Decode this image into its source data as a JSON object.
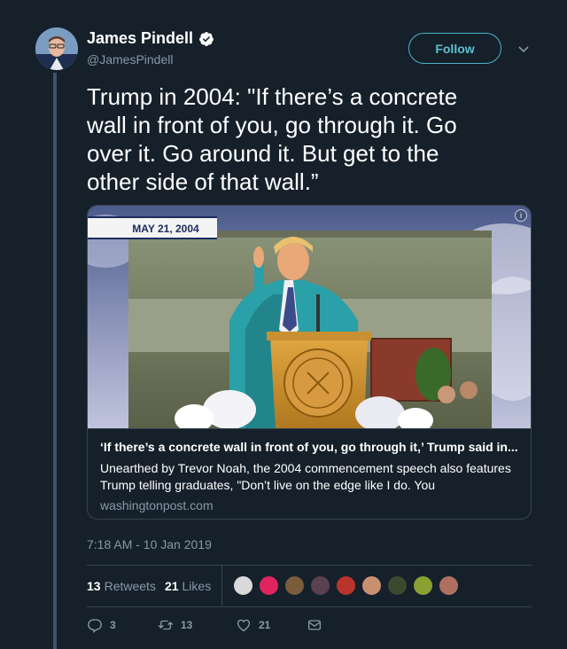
{
  "author": {
    "name": "James Pindell",
    "handle": "@JamesPindell",
    "verified": true
  },
  "follow_label": "Follow",
  "tweet_text": "Trump in 2004: \"If there’s a concrete\nwall in front of you, go through it. Go\nover it. Go around it. But get to the\nother side of that wall.”",
  "card": {
    "date_banner": "MAY 21, 2004",
    "title": "‘If there’s a concrete wall in front of you, go through it,’ Trump said in...",
    "description": "Unearthed by Trevor Noah, the 2004 commencement speech also features Trump telling graduates, \"Don’t live on the edge like I do. You",
    "domain": "washingtonpost.com",
    "info_icon": "info-icon"
  },
  "timestamp": "7:18 AM - 10 Jan 2019",
  "stats": {
    "retweets_count": "13",
    "retweets_label": "Retweets",
    "likes_count": "21",
    "likes_label": "Likes"
  },
  "likers": [
    {
      "color": "#d9d9d9"
    },
    {
      "color": "#e0245e"
    },
    {
      "color": "#7a5c3a"
    },
    {
      "color": "#5a4050"
    },
    {
      "color": "#b8342c"
    },
    {
      "color": "#c89070"
    },
    {
      "color": "#3a4a30"
    },
    {
      "color": "#8aa030"
    },
    {
      "color": "#b07060"
    }
  ],
  "actions": {
    "reply_count": "3",
    "retweet_count": "13",
    "like_count": "21"
  },
  "colors": {
    "background": "#15202b",
    "secondary_text": "#8899a6",
    "border": "#38444d",
    "accent": "#4fb2c8"
  }
}
